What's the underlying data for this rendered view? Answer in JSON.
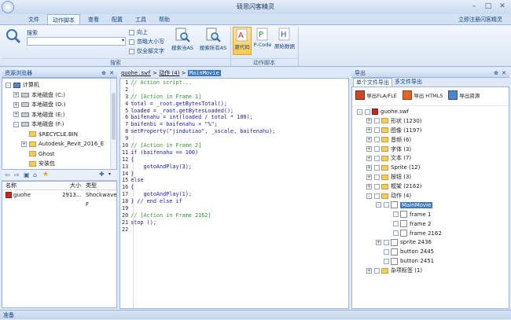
{
  "window": {
    "title": "硕思闪客精灵"
  },
  "menu": [
    "文件",
    "动作脚本",
    "查看",
    "配置",
    "工具",
    "帮助"
  ],
  "register_link": "立即注册闪客精灵",
  "ribbon": {
    "search_label": "搜索",
    "search_value": "",
    "options": [
      "向上",
      "忽略大小写",
      "仅全部文字"
    ],
    "search_current": "搜索当AS",
    "search_all": "搜索所有AS",
    "search_group": "搜索",
    "source_code": "源代码",
    "pcode": "P-Code",
    "raw_data": "原始数据",
    "as_group": "动作脚本"
  },
  "explorer": {
    "title": "资源浏览器",
    "tree": [
      {
        "label": "计算机",
        "indent": 0,
        "icon": "pc",
        "exp": "-"
      },
      {
        "label": "本地磁盘 (C:)",
        "indent": 1,
        "icon": "drive",
        "exp": "+"
      },
      {
        "label": "本地磁盘 (D:)",
        "indent": 1,
        "icon": "drive",
        "exp": "+"
      },
      {
        "label": "本地磁盘 (E:)",
        "indent": 1,
        "icon": "drive",
        "exp": "+"
      },
      {
        "label": "本地磁盘 (F:)",
        "indent": 1,
        "icon": "drive",
        "exp": "-"
      },
      {
        "label": "$RECYCLE.BIN",
        "indent": 2,
        "icon": "folder",
        "exp": ""
      },
      {
        "label": "Autodesk_Revit_2016_E",
        "indent": 2,
        "icon": "folder",
        "exp": "+"
      },
      {
        "label": "Ghost",
        "indent": 2,
        "icon": "folder",
        "exp": ""
      },
      {
        "label": "安装包",
        "indent": 2,
        "icon": "folder",
        "exp": ""
      }
    ],
    "columns": [
      "名称",
      "大小",
      "类型"
    ],
    "files": [
      {
        "name": "guohe",
        "size": "2913...",
        "type": "Shockwave F"
      }
    ]
  },
  "editor": {
    "breadcrumb": [
      "guohe.swf",
      "动作 (4)",
      "MainMovie"
    ],
    "lines": [
      "// Action script...",
      "",
      "// [Action in Frame 1]",
      "total = _root.getBytesTotal();",
      "loaded = _root.getBytesLoaded();",
      "baifenahu = int(loaded / total * 100);",
      "baifenbi = baifenahu + \"%\";",
      "setProperty(\"jindutiao\", _xscale, baifenahu);",
      "",
      "// [Action in Frame 2]",
      "if (baifenahu == 100)",
      "{",
      "    gotoAndPlay(3);",
      "}",
      "else",
      "{",
      "    gotoAndPlay(1);",
      "} // end else if",
      "",
      "// [Action in Frame 2162]",
      "stop ();",
      ""
    ]
  },
  "export": {
    "title": "导出",
    "tabs": [
      "单个文件导出",
      "多文件导出"
    ],
    "buttons": [
      "导出FLA/FLE",
      "导出 HTML5",
      "导出资源"
    ],
    "tree": [
      {
        "label": "guohe.swf",
        "indent": 0,
        "exp": "-",
        "sel": false
      },
      {
        "label": "形状 (1230)",
        "indent": 1,
        "exp": "+",
        "sel": false
      },
      {
        "label": "图像 (1197)",
        "indent": 1,
        "exp": "+",
        "sel": false
      },
      {
        "label": "音频 (6)",
        "indent": 1,
        "exp": "+",
        "sel": false
      },
      {
        "label": "字体 (3)",
        "indent": 1,
        "exp": "+",
        "sel": false
      },
      {
        "label": "文本 (7)",
        "indent": 1,
        "exp": "+",
        "sel": false
      },
      {
        "label": "Sprite (12)",
        "indent": 1,
        "exp": "+",
        "sel": false
      },
      {
        "label": "按钮 (3)",
        "indent": 1,
        "exp": "+",
        "sel": false
      },
      {
        "label": "框架 (2162)",
        "indent": 1,
        "exp": "+",
        "sel": false
      },
      {
        "label": "动作 (4)",
        "indent": 1,
        "exp": "-",
        "sel": false
      },
      {
        "label": "MainMovie",
        "indent": 2,
        "exp": "-",
        "sel": true
      },
      {
        "label": "frame 1",
        "indent": 3,
        "exp": "",
        "sel": false
      },
      {
        "label": "frame 2",
        "indent": 3,
        "exp": "",
        "sel": false
      },
      {
        "label": "frame 2162",
        "indent": 3,
        "exp": "",
        "sel": false
      },
      {
        "label": "sprite 2436",
        "indent": 2,
        "exp": "+",
        "sel": false
      },
      {
        "label": "button 2445",
        "indent": 2,
        "exp": "",
        "sel": false
      },
      {
        "label": "button 2451",
        "indent": 2,
        "exp": "",
        "sel": false
      },
      {
        "label": "杂项标签 (1)",
        "indent": 1,
        "exp": "+",
        "sel": false
      }
    ]
  },
  "status": "准备"
}
